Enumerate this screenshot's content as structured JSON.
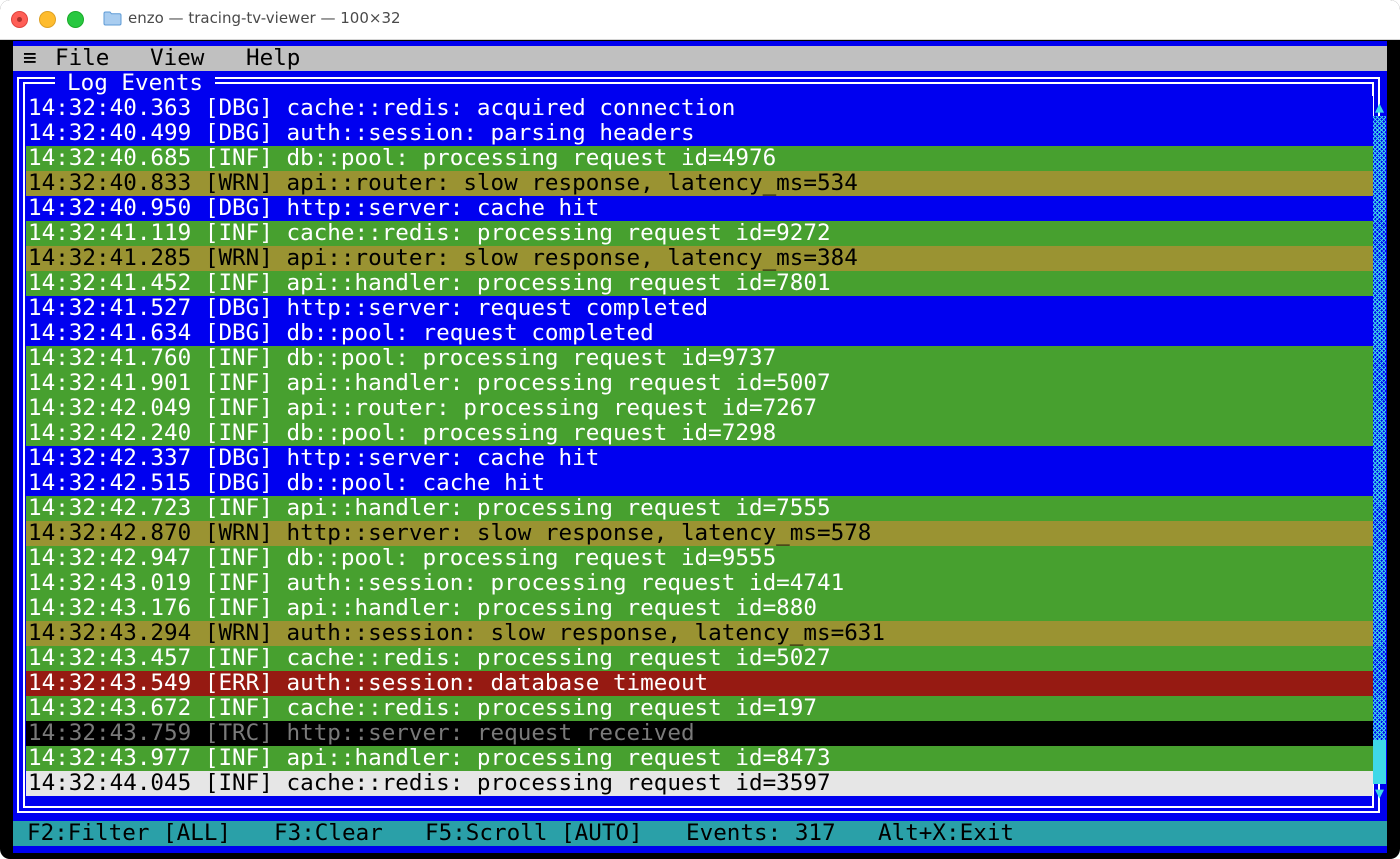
{
  "window": {
    "title": "enzo — tracing-tv-viewer — 100×32"
  },
  "menu": {
    "icon": "≡",
    "file": "File",
    "view": "View",
    "help": "Help"
  },
  "panel": {
    "title": "Log Events"
  },
  "colors": {
    "terminal_bg": "#0000f0",
    "DBG": "#0000f0",
    "INF": "#47a02f",
    "WRN": "#9a9332",
    "ERR": "#961a12",
    "TRC": "#000000",
    "selected": "#e6e6e6",
    "status_bar": "#2aa0a8",
    "scrollbar": "#3fd8e8"
  },
  "log": {
    "entries": [
      {
        "time": "14:32:40.363",
        "level": "DBG",
        "message": "cache::redis: acquired connection"
      },
      {
        "time": "14:32:40.499",
        "level": "DBG",
        "message": "auth::session: parsing headers"
      },
      {
        "time": "14:32:40.685",
        "level": "INF",
        "message": "db::pool: processing request id=4976"
      },
      {
        "time": "14:32:40.833",
        "level": "WRN",
        "message": "api::router: slow response, latency_ms=534"
      },
      {
        "time": "14:32:40.950",
        "level": "DBG",
        "message": "http::server: cache hit"
      },
      {
        "time": "14:32:41.119",
        "level": "INF",
        "message": "cache::redis: processing request id=9272"
      },
      {
        "time": "14:32:41.285",
        "level": "WRN",
        "message": "api::router: slow response, latency_ms=384"
      },
      {
        "time": "14:32:41.452",
        "level": "INF",
        "message": "api::handler: processing request id=7801"
      },
      {
        "time": "14:32:41.527",
        "level": "DBG",
        "message": "http::server: request completed"
      },
      {
        "time": "14:32:41.634",
        "level": "DBG",
        "message": "db::pool: request completed"
      },
      {
        "time": "14:32:41.760",
        "level": "INF",
        "message": "db::pool: processing request id=9737"
      },
      {
        "time": "14:32:41.901",
        "level": "INF",
        "message": "api::handler: processing request id=5007"
      },
      {
        "time": "14:32:42.049",
        "level": "INF",
        "message": "api::router: processing request id=7267"
      },
      {
        "time": "14:32:42.240",
        "level": "INF",
        "message": "db::pool: processing request id=7298"
      },
      {
        "time": "14:32:42.337",
        "level": "DBG",
        "message": "http::server: cache hit"
      },
      {
        "time": "14:32:42.515",
        "level": "DBG",
        "message": "db::pool: cache hit"
      },
      {
        "time": "14:32:42.723",
        "level": "INF",
        "message": "api::handler: processing request id=7555"
      },
      {
        "time": "14:32:42.870",
        "level": "WRN",
        "message": "http::server: slow response, latency_ms=578"
      },
      {
        "time": "14:32:42.947",
        "level": "INF",
        "message": "db::pool: processing request id=9555"
      },
      {
        "time": "14:32:43.019",
        "level": "INF",
        "message": "auth::session: processing request id=4741"
      },
      {
        "time": "14:32:43.176",
        "level": "INF",
        "message": "api::handler: processing request id=880"
      },
      {
        "time": "14:32:43.294",
        "level": "WRN",
        "message": "auth::session: slow response, latency_ms=631"
      },
      {
        "time": "14:32:43.457",
        "level": "INF",
        "message": "cache::redis: processing request id=5027"
      },
      {
        "time": "14:32:43.549",
        "level": "ERR",
        "message": "auth::session: database timeout"
      },
      {
        "time": "14:32:43.672",
        "level": "INF",
        "message": "cache::redis: processing request id=197"
      },
      {
        "time": "14:32:43.759",
        "level": "TRC",
        "message": "http::server: request received"
      },
      {
        "time": "14:32:43.977",
        "level": "INF",
        "message": "api::handler: processing request id=8473"
      },
      {
        "time": "14:32:44.045",
        "level": "INF",
        "message": "cache::redis: processing request id=3597",
        "selected": true
      }
    ],
    "scroll_position": 1.0
  },
  "scrollbar": {
    "up_icon": "▲",
    "down_icon": "▼"
  },
  "status": {
    "filter": "F2:Filter [ALL]",
    "clear": "F3:Clear",
    "scroll": "F5:Scroll [AUTO]",
    "events": "Events: 317",
    "exit": "Alt+X:Exit"
  }
}
